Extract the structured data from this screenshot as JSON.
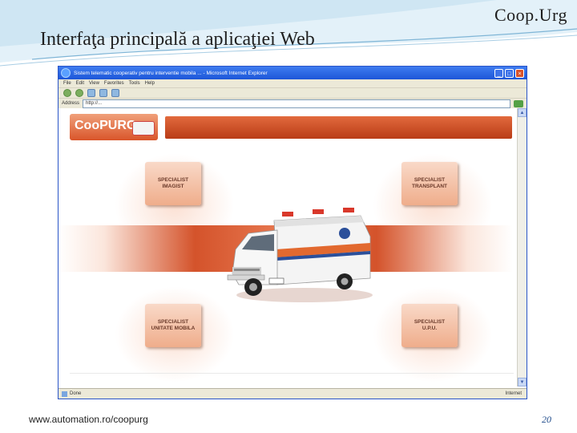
{
  "slide": {
    "title": "Interfaţa principală a aplicaţiei Web",
    "brand": "Coop.Urg",
    "footer_url": "www.automation.ro/coopurg",
    "page_number": "20"
  },
  "browser": {
    "title": "Sistem telematic cooperativ pentru interventie mobila ... - Microsoft Internet Explorer",
    "menu": [
      "File",
      "Edit",
      "View",
      "Favorites",
      "Tools",
      "Help"
    ],
    "address_label": "Address",
    "address_value": "http://...",
    "status_text": "Done",
    "status_zone": "Internet",
    "window_buttons": [
      "_",
      "□",
      "×"
    ],
    "scroll_up": "▲",
    "scroll_down": "▼"
  },
  "page": {
    "logo_text": "CooPURG",
    "buttons": {
      "imagist": "SPECIALIST\nIMAGIST",
      "transplant": "SPECIALIST\nTRANSPLANT",
      "unitate_mobila": "SPECIALIST\nUNITATE MOBILA",
      "upu": "SPECIALIST\nU.P.U."
    }
  },
  "colors": {
    "accent": "#d9552a",
    "band": "#c9471f",
    "window_blue": "#2a55c8"
  }
}
